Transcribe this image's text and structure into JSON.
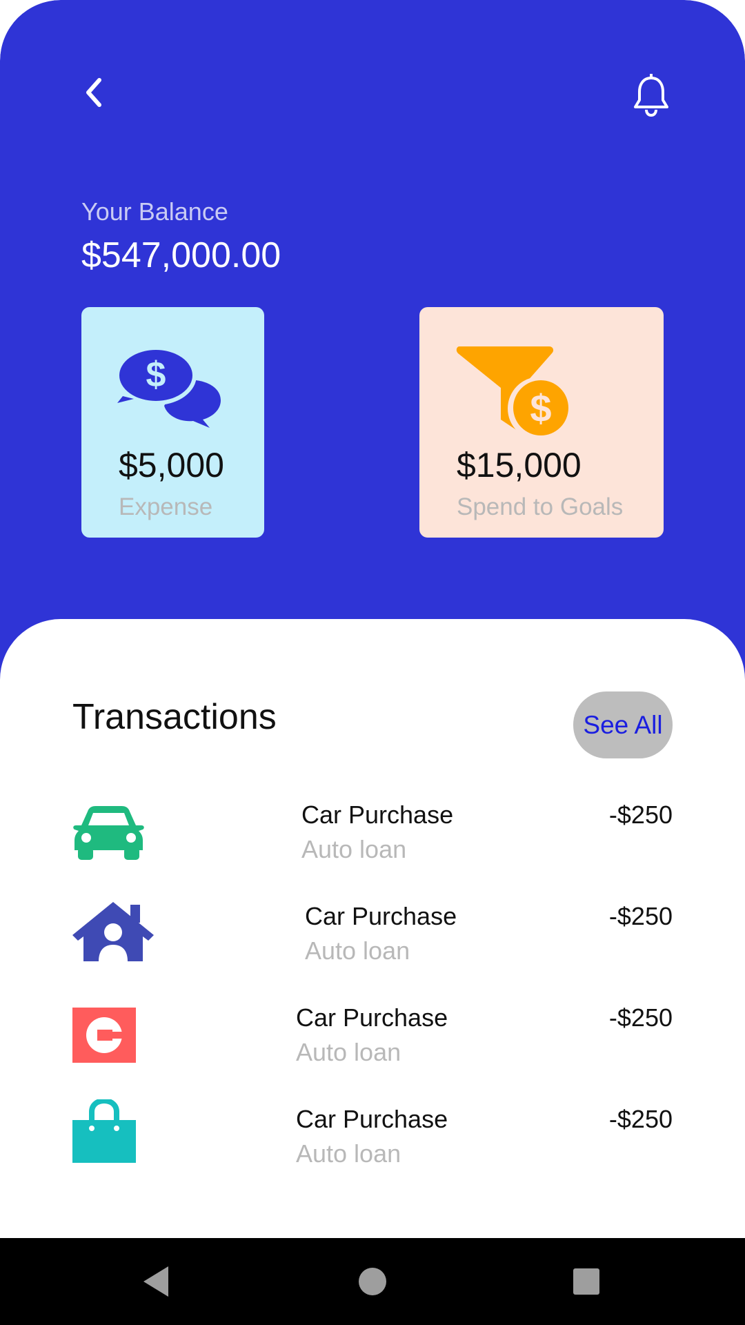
{
  "header": {
    "back_icon": "chevron-left-icon",
    "notification_icon": "bell-icon"
  },
  "balance": {
    "label": "Your Balance",
    "value": "$547,000.00"
  },
  "cards": {
    "expense": {
      "amount": "$5,000",
      "caption": "Expense",
      "icon": "money-chat-icon",
      "bg": "#c4effb"
    },
    "goals": {
      "amount": "$15,000",
      "caption": "Spend to Goals",
      "icon": "funnel-coin-icon",
      "bg": "#fde4d9"
    }
  },
  "transactions": {
    "title": "Transactions",
    "see_all_label": "See All",
    "items": [
      {
        "name": "Car Purchase",
        "sub": "Auto loan",
        "amount": "-$250",
        "icon": "car-icon",
        "color": "#1fba7f"
      },
      {
        "name": "Car Purchase",
        "sub": "Auto loan",
        "amount": "-$250",
        "icon": "house-user-icon",
        "color": "#3f4ab4"
      },
      {
        "name": "Car Purchase",
        "sub": "Auto loan",
        "amount": "-$250",
        "icon": "uber-icon",
        "color": "#ff5c5c"
      },
      {
        "name": "Car Purchase",
        "sub": "Auto loan",
        "amount": "-$250",
        "icon": "shopping-bag-icon",
        "color": "#16bfbf"
      }
    ]
  },
  "colors": {
    "primary": "#2f34d6",
    "link": "#1a1ee0",
    "muted": "#b8b8b8"
  },
  "navbar": {
    "back_icon": "triangle-back-icon",
    "home_icon": "circle-home-icon",
    "recents_icon": "square-recents-icon"
  }
}
